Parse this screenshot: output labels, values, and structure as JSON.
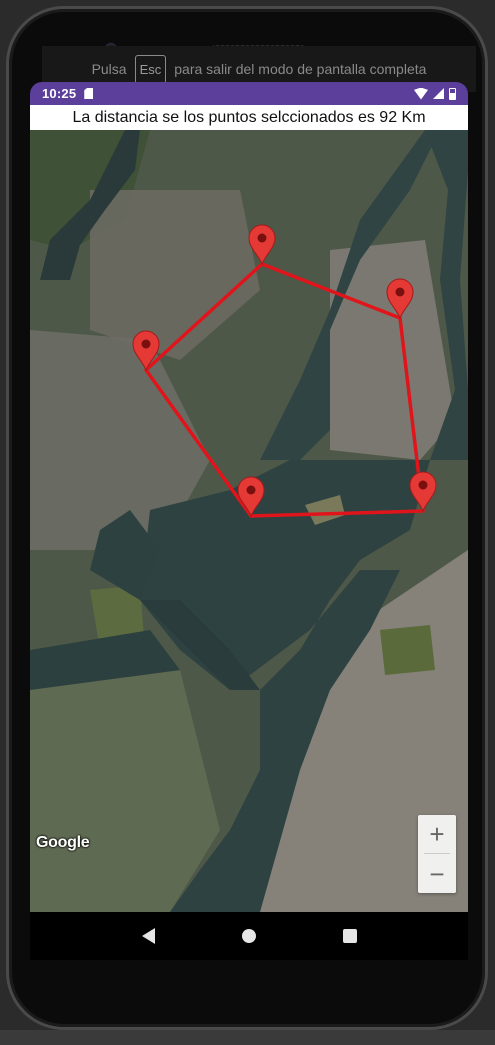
{
  "fullscreen_hint": {
    "prefix": "Pulsa",
    "key": "Esc",
    "suffix": "para salir del modo de pantalla completa"
  },
  "status_bar": {
    "time": "10:25",
    "icons": [
      "sd-card-icon",
      "wifi-icon",
      "signal-icon",
      "battery-icon"
    ]
  },
  "banner": {
    "text": "La distancia se los puntos selccionados es 92 Km"
  },
  "map": {
    "marker_count": 5,
    "route_color": "#e0151b",
    "marker_color": "#e53935",
    "attribution": "Google"
  },
  "zoom": {
    "in_label": "+",
    "out_label": "−"
  },
  "nav": {
    "buttons": [
      "back-icon",
      "home-icon",
      "recents-icon"
    ]
  }
}
